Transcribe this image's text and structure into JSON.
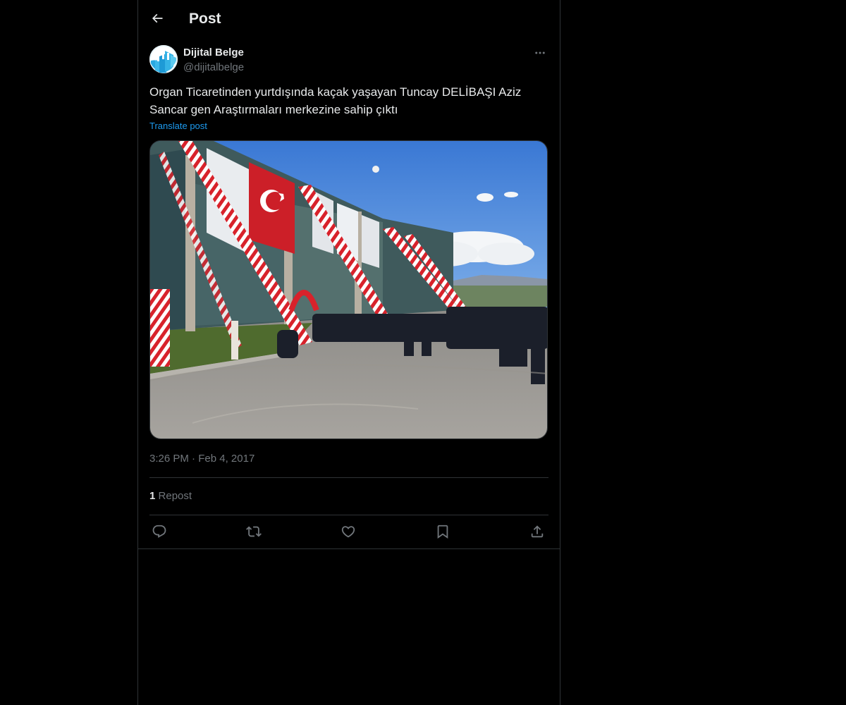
{
  "header": {
    "title": "Post"
  },
  "post": {
    "author_name": "Dijital Belge",
    "author_handle": "@dijitalbelge",
    "text": "Organ Ticaretinden yurtdışında kaçak yaşayan Tuncay DELİBAŞI Aziz Sancar gen Araştırmaları merkezine sahip çıktı",
    "translate_label": "Translate post",
    "time": "3:26 PM",
    "separator": "·",
    "date": "Feb 4, 2017",
    "repost_count": "1",
    "repost_label": "Repost"
  },
  "icons": {
    "back": "arrow-left-icon",
    "more": "more-icon",
    "reply": "reply-icon",
    "repost": "repost-icon",
    "like": "heart-icon",
    "bookmark": "bookmark-icon",
    "share": "share-icon"
  },
  "colors": {
    "background": "#000000",
    "text": "#e7e9ea",
    "secondary_text": "#71767b",
    "border": "#2f3336",
    "link": "#1d9bf0"
  }
}
